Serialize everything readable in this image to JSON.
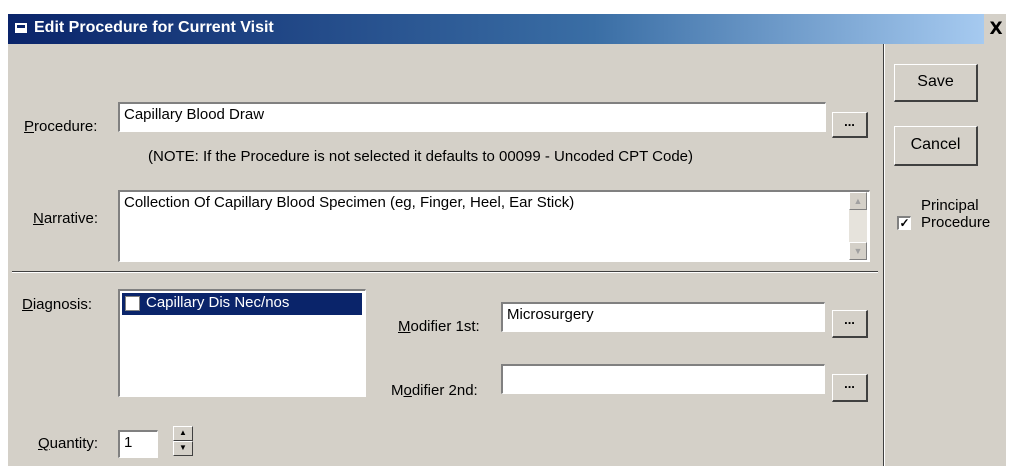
{
  "window": {
    "title": "Edit Procedure for Current Visit",
    "close_label": "X"
  },
  "procedure": {
    "label_prefix": "",
    "label_underline": "P",
    "label_rest": "rocedure:",
    "value": "Capillary Blood Draw",
    "browse_label": "..."
  },
  "note": "(NOTE: If the Procedure is not selected it defaults to 00099 - Uncoded CPT Code)",
  "narrative": {
    "label_underline": "N",
    "label_rest": "arrative:",
    "value": "Collection Of Capillary Blood Specimen (eg, Finger, Heel, Ear Stick)"
  },
  "diagnosis": {
    "label_underline": "D",
    "label_rest": "iagnosis:",
    "items": [
      {
        "label": "Capillary Dis Nec/nos",
        "checked": false,
        "selected": true
      }
    ]
  },
  "modifier1": {
    "label_underline": "M",
    "label_rest": "odifier 1st:",
    "value": "Microsurgery",
    "browse_label": "..."
  },
  "modifier2": {
    "label_prefix": "M",
    "label_underline": "o",
    "label_rest": "difier 2nd:",
    "value": "",
    "browse_label": "..."
  },
  "quantity": {
    "label_underline": "Q",
    "label_rest": "uantity:",
    "value": "1"
  },
  "actions": {
    "save_label": "Save",
    "cancel_label": "Cancel"
  },
  "principal": {
    "checked": true,
    "check_mark": "✓",
    "label_line1": "Principal",
    "label_line2": "Procedure"
  },
  "colors": {
    "title_bar": "#0a246a",
    "selection": "#0a246a",
    "dialog_bg": "#d4d0c8"
  }
}
